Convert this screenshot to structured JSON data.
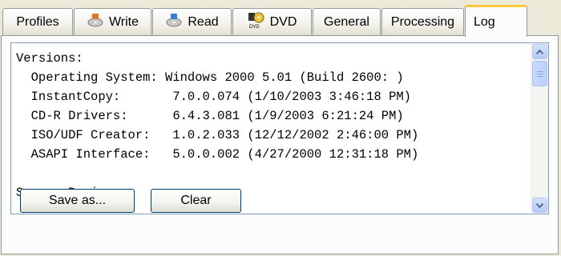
{
  "tabs": [
    {
      "label": "Profiles",
      "icon": null
    },
    {
      "label": "Write",
      "icon": "cd-write-icon"
    },
    {
      "label": "Read",
      "icon": "cd-read-icon"
    },
    {
      "label": "DVD",
      "icon": "dvd-icon"
    },
    {
      "label": "General",
      "icon": null
    },
    {
      "label": "Processing",
      "icon": null
    },
    {
      "label": "Log",
      "icon": null,
      "active": true
    }
  ],
  "log": {
    "lines": [
      "Versions:",
      "  Operating System: Windows 2000 5.01 (Build 2600: )",
      "  InstantCopy:       7.0.0.074 (1/10/2003 3:46:18 PM)",
      "  CD-R Drivers:      6.4.3.081 (1/9/2003 6:21:24 PM)",
      "  ISO/UDF Creator:   1.0.2.033 (12/12/2002 2:46:00 PM)",
      "  ASAPI Interface:   5.0.0.002 (4/27/2000 12:31:18 PM)",
      "",
      "Source Device:"
    ]
  },
  "buttons": {
    "save_as": "Save as...",
    "clear": "Clear"
  },
  "colors": {
    "active_tab_accent": "#ffc83c",
    "panel_bg": "#fcfcfe",
    "window_bg": "#ece9d8"
  }
}
